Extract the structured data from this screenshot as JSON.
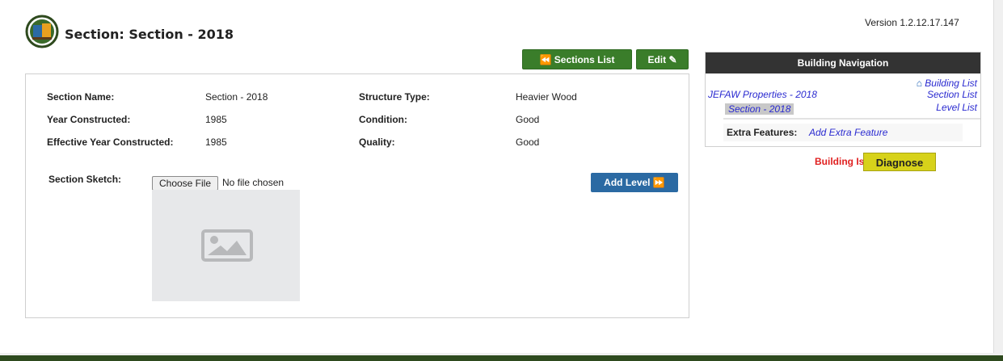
{
  "version": "Version 1.2.12.17.147",
  "page_title": "Section: Section - 2018",
  "buttons": {
    "sections_list": "Sections List",
    "edit": "Edit",
    "add_level": "Add Level",
    "diagnose": "Diagnose",
    "choose_file": "Choose File"
  },
  "section": {
    "name_label": "Section Name:",
    "name_value": "Section - 2018",
    "year_label": "Year Constructed:",
    "year_value": "1985",
    "eff_year_label": "Effective Year Constructed:",
    "eff_year_value": "1985",
    "structure_label": "Structure Type:",
    "structure_value": "Heavier Wood",
    "condition_label": "Condition:",
    "condition_value": "Good",
    "quality_label": "Quality:",
    "quality_value": "Good",
    "sketch_label": "Section Sketch:",
    "no_file": "No file chosen"
  },
  "nav": {
    "header": "Building Navigation",
    "building_list": "Building List",
    "section_list": "Section List",
    "level_list": "Level List",
    "property_link": "JEFAW Properties - 2018",
    "section_link": "Section - 2018",
    "extra_label": "Extra Features:",
    "extra_link": "Add Extra Feature"
  },
  "status": {
    "incomplete": "Building Is Incomplete"
  },
  "colors": {
    "green_button": "#3a7d2a",
    "blue_button": "#2b6aa3",
    "diagnose": "#d7d21a",
    "error_text": "#e02020",
    "nav_header": "#333333",
    "link": "#2a2ad0"
  }
}
